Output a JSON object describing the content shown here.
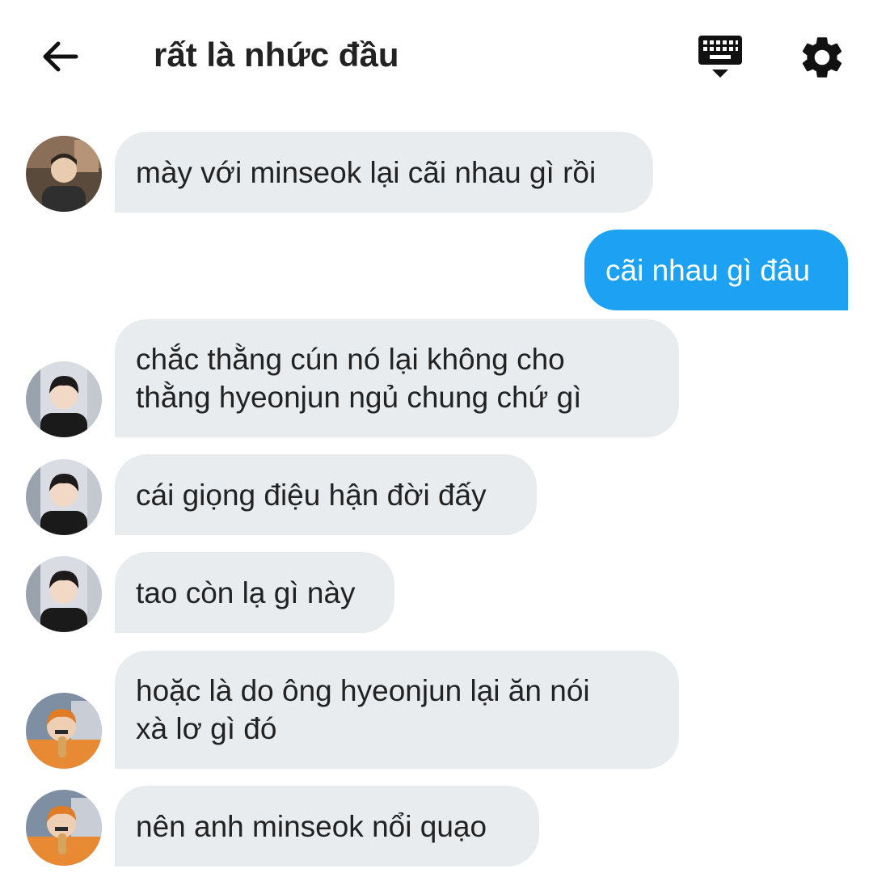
{
  "header": {
    "title": "rất là nhức đầu",
    "back_icon": "arrow-left-icon",
    "keyboard_icon": "keyboard-icon",
    "settings_icon": "gear-icon"
  },
  "colors": {
    "incoming_bubble": "#e8ecef",
    "outgoing_bubble": "#1da1f2",
    "text": "#222222"
  },
  "messages": [
    {
      "direction": "incoming",
      "sender": "user-a",
      "text": "mày với minseok lại cãi nhau gì rồi"
    },
    {
      "direction": "outgoing",
      "text": "cãi nhau gì đâu"
    },
    {
      "direction": "incoming",
      "sender": "user-b",
      "line1": "chắc thằng cún nó lại không cho",
      "line2": "thằng hyeonjun ngủ chung chứ gì"
    },
    {
      "direction": "incoming",
      "sender": "user-b",
      "text": "cái giọng điệu hận đời đấy"
    },
    {
      "direction": "incoming",
      "sender": "user-b",
      "text": "tao còn lạ gì này"
    },
    {
      "direction": "incoming",
      "sender": "user-c",
      "line1": "hoặc là do ông hyeonjun lại ăn nói",
      "line2": "xà lơ gì đó"
    },
    {
      "direction": "incoming",
      "sender": "user-c",
      "text": "nên anh minseok nổi quạo"
    }
  ]
}
